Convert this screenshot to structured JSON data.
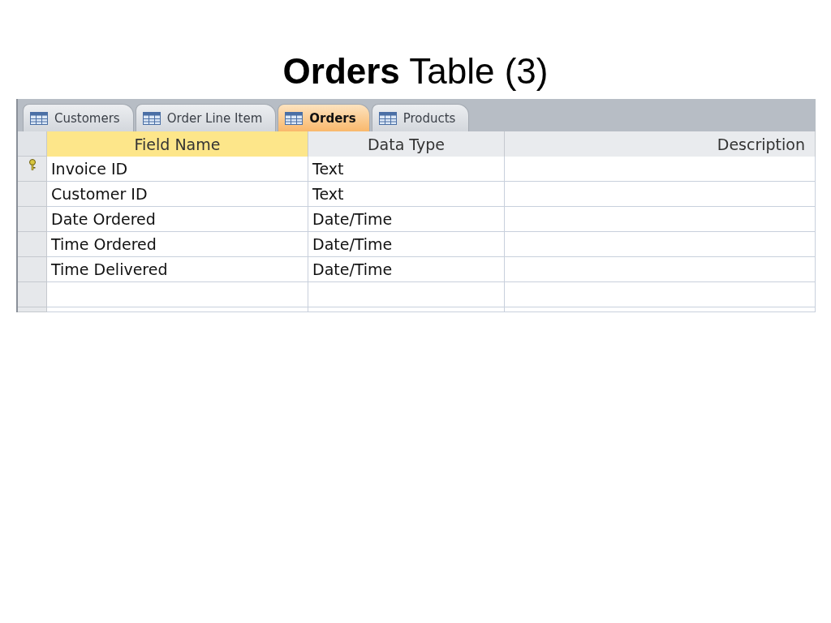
{
  "slide_title": "**Orders** Table (3)",
  "tabs": [
    {
      "label": "Customers",
      "selected": false
    },
    {
      "label": "Order Line Item",
      "selected": false
    },
    {
      "label": "Orders",
      "selected": true
    },
    {
      "label": "Products",
      "selected": false
    }
  ],
  "table": {
    "columns": [
      {
        "label": "Field Name",
        "selected": true
      },
      {
        "label": "Data Type",
        "selected": false
      },
      {
        "label": "Description",
        "selected": false
      }
    ],
    "rows": [
      {
        "field_name": "Invoice ID",
        "data_type": "Text",
        "primary_key": true
      },
      {
        "field_name": "Customer ID",
        "data_type": "Text",
        "primary_key": false
      },
      {
        "field_name": "Date Ordered",
        "data_type": "Date/Time",
        "primary_key": false
      },
      {
        "field_name": "Time Ordered",
        "data_type": "Date/Time",
        "primary_key": false
      },
      {
        "field_name": "Time Delivered",
        "data_type": "Date/Time",
        "primary_key": false
      }
    ]
  }
}
